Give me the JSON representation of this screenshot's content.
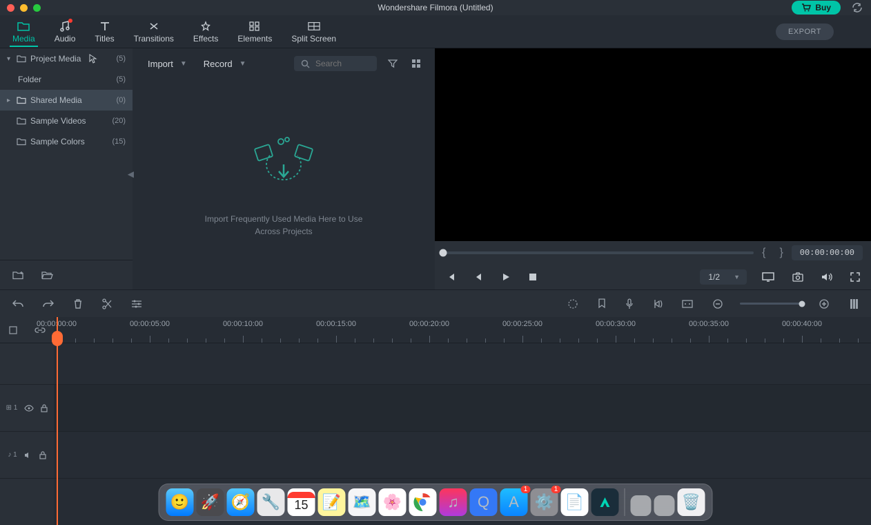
{
  "titlebar": {
    "title": "Wondershare Filmora (Untitled)",
    "buy_label": "Buy"
  },
  "tabs": [
    {
      "label": "Media",
      "icon": "folder"
    },
    {
      "label": "Audio",
      "icon": "music"
    },
    {
      "label": "Titles",
      "icon": "text"
    },
    {
      "label": "Transitions",
      "icon": "transition"
    },
    {
      "label": "Effects",
      "icon": "effects"
    },
    {
      "label": "Elements",
      "icon": "elements"
    },
    {
      "label": "Split Screen",
      "icon": "splitscreen"
    }
  ],
  "active_tab": 0,
  "export_label": "EXPORT",
  "sidebar": {
    "items": [
      {
        "label": "Project Media",
        "count": "(5)",
        "has_folder": true,
        "has_chev": true,
        "selected": false
      },
      {
        "label": "Folder",
        "count": "(5)",
        "indent": true,
        "selected": false
      },
      {
        "label": "Shared Media",
        "count": "(0)",
        "has_folder": true,
        "has_chev": true,
        "selected": true
      },
      {
        "label": "Sample Videos",
        "count": "(20)",
        "has_folder": true,
        "selected": false
      },
      {
        "label": "Sample Colors",
        "count": "(15)",
        "has_folder": true,
        "selected": false
      }
    ]
  },
  "media": {
    "import_label": "Import",
    "record_label": "Record",
    "search_placeholder": "Search",
    "empty_hint": "Import Frequently Used Media Here to Use Across Projects"
  },
  "preview": {
    "timecode": "00:00:00:00",
    "quality": "1/2"
  },
  "timeline": {
    "ruler": [
      "00:00:00:00",
      "00:00:05:00",
      "00:00:10:00",
      "00:00:15:00",
      "00:00:20:00",
      "00:00:25:00",
      "00:00:30:00",
      "00:00:35:00",
      "00:00:40:00"
    ]
  },
  "dock": {
    "calendar_day": "15",
    "appstore_badge": "1",
    "settings_badge": "1"
  }
}
